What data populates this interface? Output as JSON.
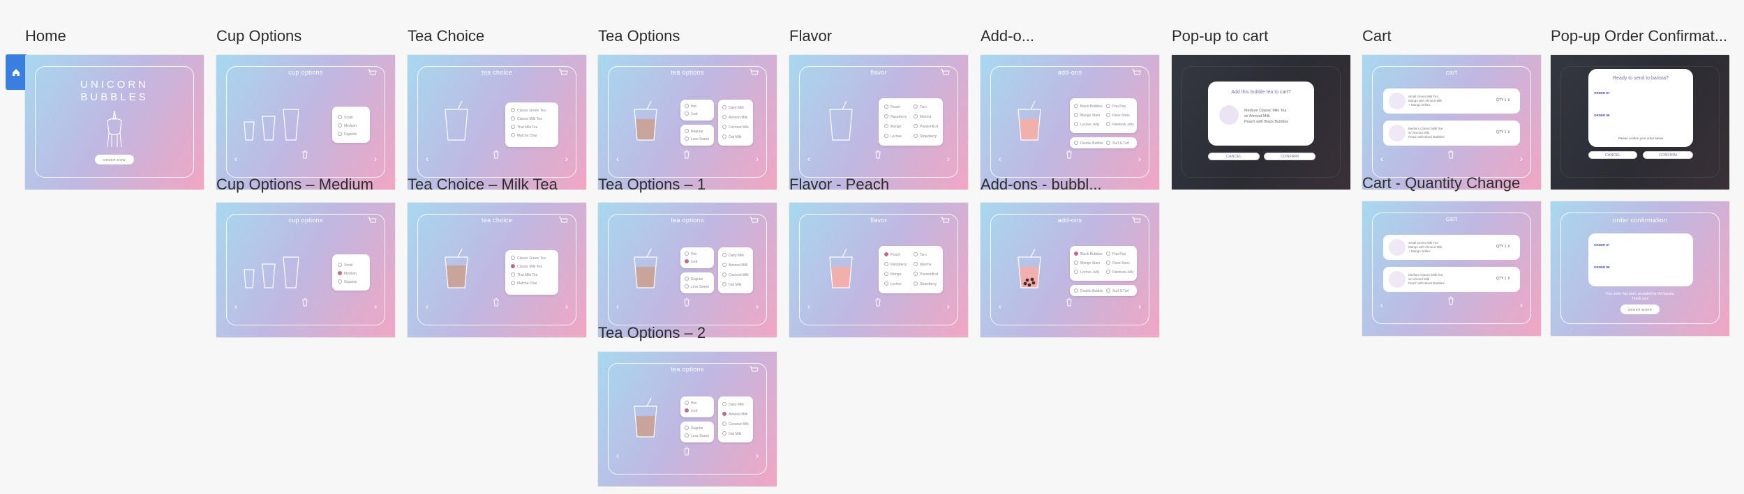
{
  "artboards": {
    "home": "Home",
    "cup_options": "Cup Options",
    "tea_choice": "Tea Choice",
    "tea_options": "Tea Options",
    "flavor": "Flavor",
    "addons": "Add-o...",
    "popup_cart": "Pop-up to cart",
    "cart": "Cart",
    "popup_order": "Pop-up Order Confirmat...",
    "cup_medium": "Cup Options – Medium",
    "tea_milk": "Tea Choice – Milk Tea",
    "tea_options_1": "Tea Options – 1",
    "flavor_peach": "Flavor - Peach",
    "addons_bubble": "Add-ons - bubbl...",
    "cart_qty": "Cart - Quantity Change",
    "tea_options_2": "Tea Options – 2"
  },
  "screens": {
    "home_logo_1": "UNICORN",
    "home_logo_2": "BUBBLES",
    "order_now": "ORDER NOW",
    "cup_title": "cup options",
    "tea_choice_title": "tea choice",
    "tea_options_title": "tea options",
    "flavor_title": "flavor",
    "addons_title": "add-ons",
    "cart_title": "cart",
    "order_conf_title": "order confirmation",
    "sizes": [
      "Small",
      "Medium",
      "Gigantic"
    ],
    "teas": [
      "Classic Green Tea",
      "Classic Milk Tea",
      "Thai Milk Tea",
      "Matcha Chai"
    ],
    "ice": [
      "Hot",
      "Iced"
    ],
    "sweet": [
      "Regular",
      "Less Sweet"
    ],
    "milks": [
      "Dairy Milk",
      "Almond Milk",
      "Coconut Milk",
      "Oat Milk"
    ],
    "flavors_a": [
      "Peach",
      "Raspberry",
      "Mango",
      "Lychee"
    ],
    "flavors_b": [
      "Taro",
      "Matcha",
      "Passionfruit",
      "Strawberry"
    ],
    "addons_a": [
      "Black Bubbles",
      "Mango Stars",
      "Lychee Jelly"
    ],
    "addons_b": [
      "Pop Pop",
      "Rose Stars",
      "Rainbow Jelly"
    ],
    "addons_c": [
      "Double Bubble",
      "Surf & Turf"
    ],
    "popup_question": "Add this bubble tea to cart?",
    "popup_item_1": "Medium Classic Milk Tea",
    "popup_item_2": "w/ Almond Milk",
    "popup_item_3": "Peach with Black Bubbles",
    "cancel": "CANCEL",
    "confirm": "CONFIRM",
    "order_question": "Ready to send to barista?",
    "order_hint": "Please confirm your order below",
    "qty_label": "QTY",
    "qty_val": "1",
    "cart_item_1": "Small Green Milk Tea",
    "cart_item_1b": "Mango with Almond Milk",
    "cart_item_1c": "+ Mango Jellies",
    "cart_item_2": "Medium Classic Milk Tea",
    "cart_item_2b": "w/ Almond Milk",
    "cart_item_2c": "Peach with Black Bubbles",
    "oc_order_1": "ORDER 87",
    "oc_order_2": "ORDER 88",
    "oc_note_1": "Your order has been accepted by the barista.",
    "oc_note_2": "Thank you!",
    "oc_button": "ORDER MORE",
    "faded_bg": "Order Confirmation"
  }
}
